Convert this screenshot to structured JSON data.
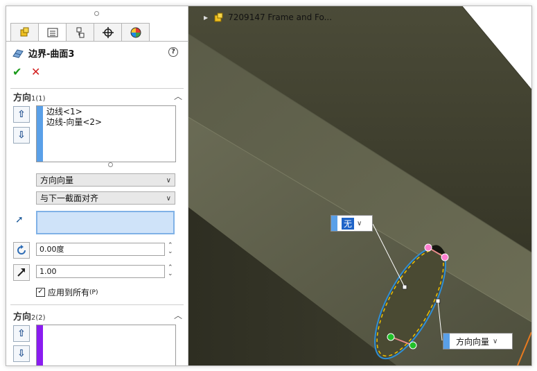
{
  "property_manager": {
    "title": "边界-曲面3",
    "help": "?",
    "ok_glyph": "✔",
    "cancel_glyph": "✕",
    "direction1": {
      "title": "方向",
      "count": "1(1)",
      "items": [
        "边线<1>",
        "边线-向量<2>"
      ],
      "tangent_type": "方向向量",
      "alignment": "与下一截面对齐",
      "angle": "0.00度",
      "tangent_length": "1.00",
      "apply_all_label": "应用到所有",
      "apply_all_suffix": "(P)",
      "apply_all_checked": true
    },
    "direction2": {
      "title": "方向",
      "count": "2(2)"
    },
    "colors": {
      "dir1_bar": "#5aa0e8",
      "dir2_bar": "#8a1cf0"
    }
  },
  "viewport": {
    "document_title": "7209147 Frame and Fo...",
    "callout_none": "无",
    "callout_direction": "方向向量"
  }
}
